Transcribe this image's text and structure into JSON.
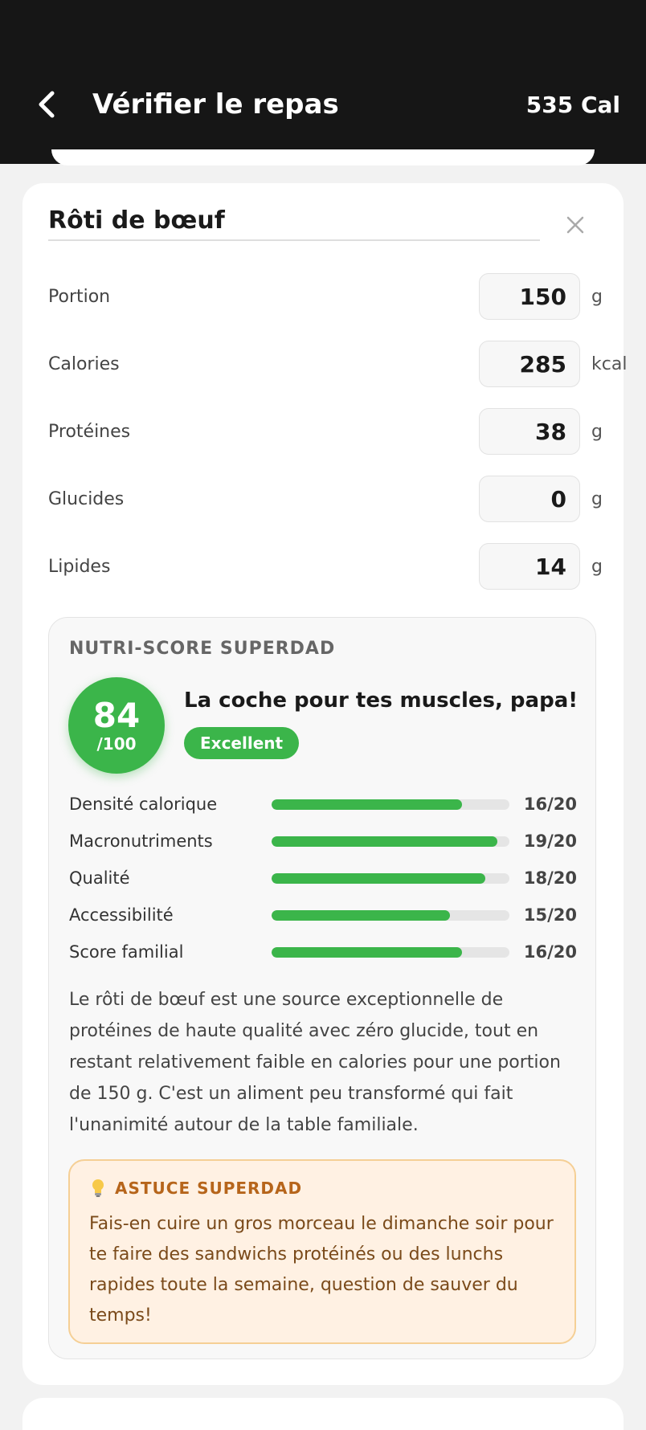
{
  "header": {
    "title": "Vérifier le repas",
    "calories": "535 Cal",
    "back_icon": "chevron-left-icon"
  },
  "food": {
    "name": "Rôti de bœuf",
    "close_icon": "close-icon",
    "fields": [
      {
        "label": "Portion",
        "value": "150",
        "unit": "g"
      },
      {
        "label": "Calories",
        "value": "285",
        "unit": "kcal"
      },
      {
        "label": "Protéines",
        "value": "38",
        "unit": "g"
      },
      {
        "label": "Glucides",
        "value": "0",
        "unit": "g"
      },
      {
        "label": "Lipides",
        "value": "14",
        "unit": "g"
      }
    ]
  },
  "nutri_score": {
    "title": "NUTRI-SCORE SUPERDAD",
    "score": "84",
    "max": "/100",
    "headline": "La coche pour tes muscles, papa!",
    "badge": "Excellent",
    "accent_color": "#3bb54a",
    "metrics": [
      {
        "label": "Densité calorique",
        "value": "16/20",
        "fraction": 0.8
      },
      {
        "label": "Macronutriments",
        "value": "19/20",
        "fraction": 0.95
      },
      {
        "label": "Qualité",
        "value": "18/20",
        "fraction": 0.9
      },
      {
        "label": "Accessibilité",
        "value": "15/20",
        "fraction": 0.75
      },
      {
        "label": "Score familial",
        "value": "16/20",
        "fraction": 0.8
      }
    ],
    "description": "Le rôti de bœuf est une source exceptionnelle de protéines de haute qualité avec zéro glucide, tout en restant relativement faible en calories pour une portion de 150 g. C'est un aliment peu transformé qui fait l'unanimité autour de la table familiale.",
    "tip": {
      "icon": "lightbulb-icon",
      "title": "ASTUCE SUPERDAD",
      "text": "Fais-en cuire un gros morceau le dimanche soir pour te faire des sandwichs protéinés ou des lunchs rapides toute la semaine, question de sauver du temps!"
    }
  }
}
